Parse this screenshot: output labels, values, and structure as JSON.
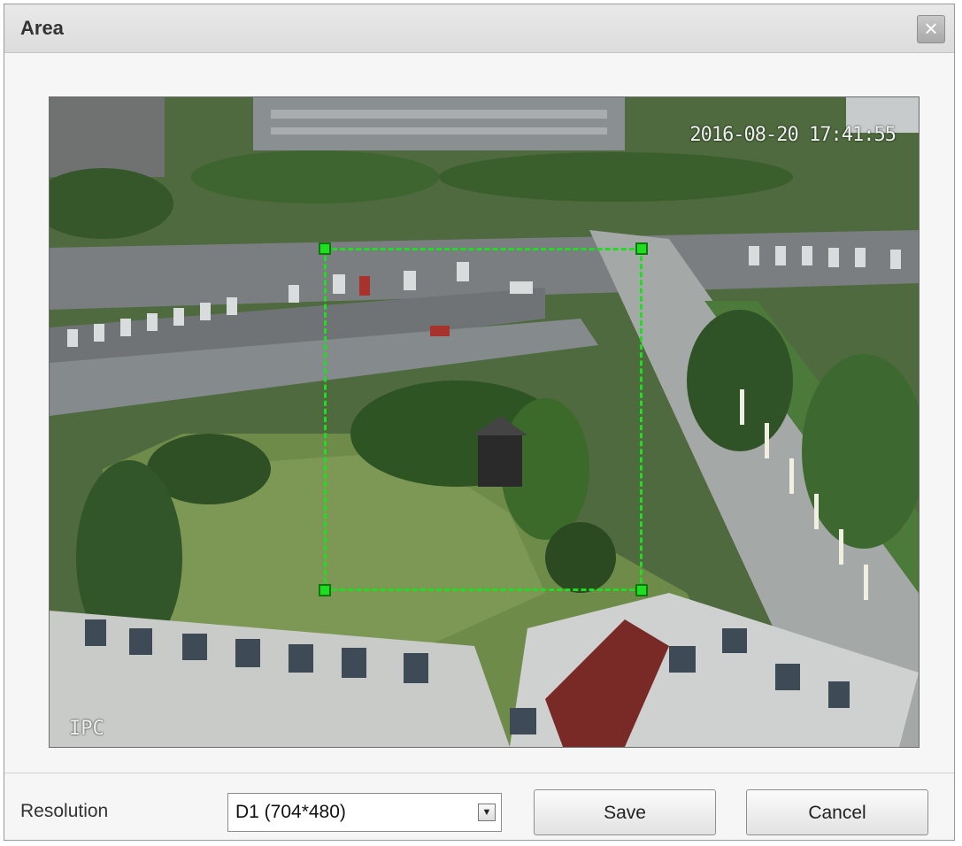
{
  "dialog": {
    "title": "Area",
    "close_label": "×"
  },
  "video": {
    "timestamp": "2016-08-20 17:41:55",
    "channel_name": "IPC"
  },
  "controls": {
    "resolution_label": "Resolution",
    "resolution_value": "D1 (704*480)",
    "dropdown_arrow": "▼",
    "save_label": "Save",
    "cancel_label": "Cancel"
  },
  "colors": {
    "roi": "#21dd21",
    "titlebar": "#dcdcdc"
  }
}
